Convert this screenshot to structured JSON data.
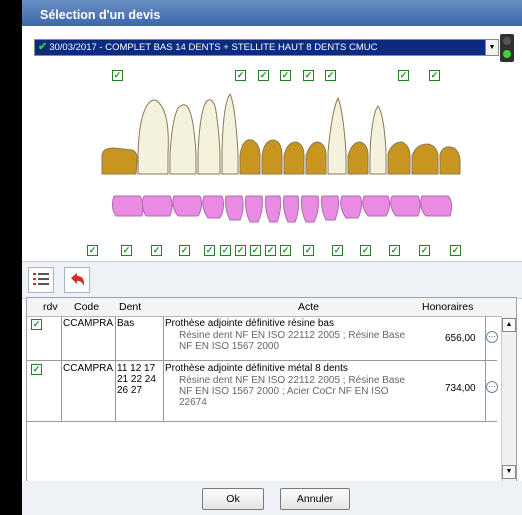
{
  "window": {
    "title": "Sélection d'un devis"
  },
  "devis_select": {
    "value": "30/03/2017 - COMPLET BAS 14 DENTS + STELLITE HAUT 8 DENTS CMUC",
    "check": "✔",
    "arrow": "▼"
  },
  "teeth_checkbox_mark": "✓",
  "icons": {
    "list": "list-icon",
    "undo": "undo-arrow-icon",
    "traffic": "traffic-light-icon"
  },
  "table": {
    "headers": {
      "rdv": "rdv",
      "code": "Code",
      "dent": "Dent",
      "acte": "Acte",
      "honoraires": "Honoraires"
    },
    "rows": [
      {
        "checked": "✓",
        "code": "CCAMPRA",
        "dent": "Bas",
        "acte_title": "Prothèse adjointe définitive résine bas",
        "acte_detail": "Résine dent NF EN ISO 22112 2005 ; Résine Base NF EN ISO 1567 2000",
        "honoraires": "656,00",
        "more": "···"
      },
      {
        "checked": "✓",
        "code": "CCAMPRA",
        "dent": "11 12 17 21 22 24 26 27",
        "acte_title": "Prothèse adjointe définitive métal 8 dents",
        "acte_detail": "Résine dent NF EN ISO 22112 2005 ; Résine Base NF EN ISO 1567 2000 ; Acier CoCr NF EN ISO 22674",
        "honoraires": "734,00",
        "more": "···"
      }
    ],
    "scroll_up": "▲",
    "scroll_down": "▼"
  },
  "footer": {
    "ok": "Ok",
    "cancel": "Annuler"
  },
  "colors": {
    "metal": "#c8961e",
    "resin": "#e98be3",
    "natural": "#f4f1dc",
    "title": "#4e78b5"
  }
}
